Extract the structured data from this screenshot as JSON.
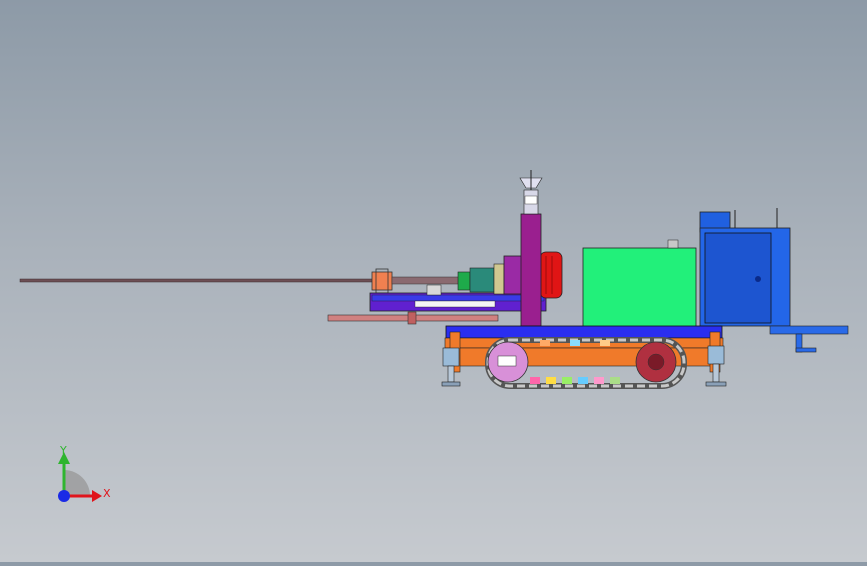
{
  "window": {
    "title": ""
  },
  "triad": {
    "x_label": "X",
    "y_label": "Y",
    "x_color": "#e0141b",
    "y_color": "#2fb52f",
    "z_color": "#1a2ae6"
  },
  "model": {
    "description_icon": "drilling-rig-assembly",
    "colors": {
      "frame_orange": "#f07a2a",
      "deck_blue": "#2a2ef0",
      "cabinet_blue": "#1e5de8",
      "tank_green": "#22ee7a",
      "motor_purple": "#9a1f9f",
      "motor_red": "#e01010",
      "rod_gray": "#7a5860",
      "track_gray": "#8a8a8a"
    }
  }
}
